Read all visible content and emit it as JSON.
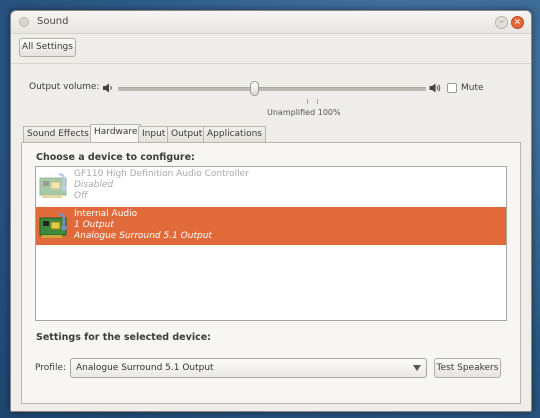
{
  "window": {
    "title": "Sound"
  },
  "toolbar": {
    "all_settings": "All Settings"
  },
  "volume": {
    "label": "Output volume:",
    "mute_label": "Mute",
    "unamplified_label": "Unamplified 100%",
    "muted": false
  },
  "tabs": [
    {
      "label": "Sound Effects",
      "active": false
    },
    {
      "label": "Hardware",
      "active": true
    },
    {
      "label": "Input",
      "active": false
    },
    {
      "label": "Output",
      "active": false
    },
    {
      "label": "Applications",
      "active": false
    }
  ],
  "hardware": {
    "choose_heading": "Choose a device to configure:",
    "devices": [
      {
        "name": "GF110 High Definition Audio Controller",
        "line2": "Disabled",
        "line3": "Off",
        "selected": false
      },
      {
        "name": "Internal Audio",
        "line2": "1 Output",
        "line3": "Analogue Surround 5.1 Output",
        "selected": true
      }
    ],
    "settings_heading": "Settings for the selected device:",
    "profile_label": "Profile:",
    "profile_value": "Analogue Surround 5.1 Output",
    "test_speakers": "Test Speakers"
  },
  "colors": {
    "selection": "#e06a3a",
    "close_button": "#e4673a"
  },
  "icons": [
    "speaker-low-icon",
    "speaker-high-icon",
    "sound-card-icon",
    "dropdown-arrow-icon",
    "close-icon",
    "minimize-icon"
  ]
}
